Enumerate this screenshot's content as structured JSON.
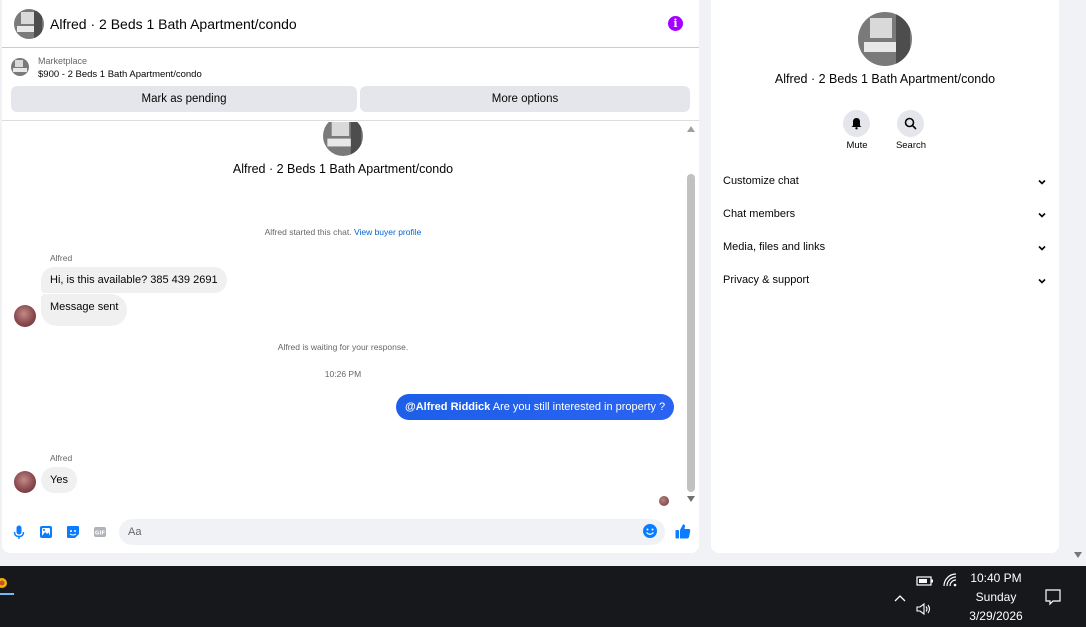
{
  "chat": {
    "header_title": "Alfred · 2 Beds 1 Bath Apartment/condo",
    "listing_source": "Marketplace",
    "listing_price_title": "$900 - 2 Beds 1 Bath Apartment/condo",
    "mark_pending_label": "Mark as pending",
    "more_options_label": "More options",
    "conversation_title": "Alfred · 2 Beds 1 Bath Apartment/condo",
    "started_note": "Alfred started this chat.",
    "view_buyer_profile": "View buyer profile",
    "waiting_note": "Alfred is waiting for your response.",
    "timestamp": "10:26 PM",
    "messages": [
      {
        "sender": "Alfred",
        "text": "Hi, is this available? 385 439 2691"
      },
      {
        "text": "Message sent"
      },
      {
        "mention": "@Alfred Riddick",
        "text": "Are you still interested in property ?"
      },
      {
        "sender": "Alfred",
        "text": "Yes"
      }
    ],
    "composer_placeholder": "Aa"
  },
  "info": {
    "title": "Alfred · 2 Beds 1 Bath Apartment/condo",
    "mute_label": "Mute",
    "search_label": "Search",
    "sections": [
      "Customize chat",
      "Chat members",
      "Media, files and links",
      "Privacy & support"
    ]
  },
  "taskbar": {
    "time": "10:40 PM",
    "day": "Sunday",
    "date": "3/29/2026"
  },
  "colors": {
    "accent": "#0a7cff",
    "info_icon": "#a200ff",
    "link": "#0064d1"
  },
  "icons": [
    "info-icon",
    "microphone-icon",
    "photo-icon",
    "sticker-icon",
    "gif-icon",
    "emoji-icon",
    "thumbs-up-icon",
    "bell-icon",
    "search-icon",
    "chevron-down-icon",
    "battery-icon",
    "wifi-icon",
    "volume-icon",
    "notification-icon"
  ]
}
